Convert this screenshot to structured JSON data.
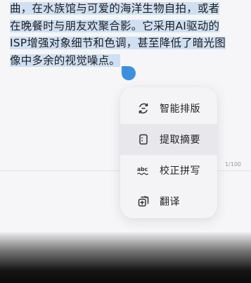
{
  "editor": {
    "selected_lines": [
      "曲，在水族馆与可爱的海洋生物自拍，或者",
      "在晚餐时与朋友欢聚合影。它采用AI驱动的",
      "ISP增强对象细节和色调，甚至降低了暗光图",
      "像中多余的视觉噪点。"
    ],
    "char_counter": "1/100"
  },
  "context_menu": {
    "items": [
      {
        "label": "智能排版",
        "icon": "smart-layout-icon"
      },
      {
        "label": "提取摘要",
        "icon": "summary-icon"
      },
      {
        "label": "校正拼写",
        "icon": "spellcheck-icon"
      },
      {
        "label": "翻译",
        "icon": "translate-icon"
      }
    ]
  },
  "colors": {
    "selection": "#cfe0f3",
    "handle": "#3d8fe0",
    "menu_bg": "#f4f4f6",
    "menu_active": "#e7e7ec"
  }
}
